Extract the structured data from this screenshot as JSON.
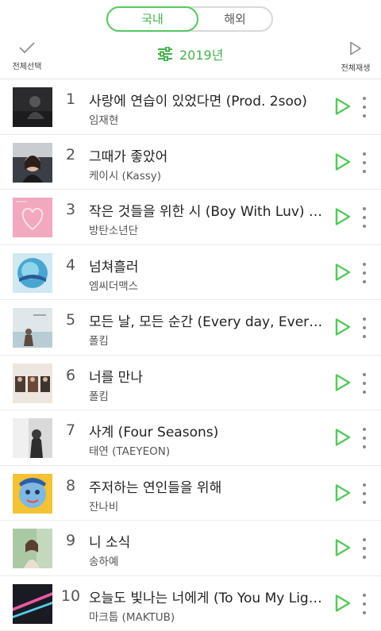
{
  "tabs": {
    "domestic": "국내",
    "international": "해외"
  },
  "toolbar": {
    "select_all": "전체선택",
    "play_all": "전체재생",
    "year": "2019년"
  },
  "colors": {
    "accent": "#44b24b"
  },
  "songs": [
    {
      "rank": "1",
      "title": "사랑에 연습이 있었다면 (Prod. 2soo)",
      "artist": "임재현"
    },
    {
      "rank": "2",
      "title": "그때가 좋았어",
      "artist": "케이시 (Kassy)"
    },
    {
      "rank": "3",
      "title": "작은 것들을 위한 시 (Boy With Luv) (Feat. Halsey)",
      "artist": "방탄소년단"
    },
    {
      "rank": "4",
      "title": "넘쳐흘러",
      "artist": "엠씨더맥스"
    },
    {
      "rank": "5",
      "title": "모든 날, 모든 순간 (Every day, Every Moment)",
      "artist": "폴킴"
    },
    {
      "rank": "6",
      "title": "너를 만나",
      "artist": "폴킴"
    },
    {
      "rank": "7",
      "title": "사계 (Four Seasons)",
      "artist": "태연 (TAEYEON)"
    },
    {
      "rank": "8",
      "title": "주저하는 연인들을 위해",
      "artist": "잔나비"
    },
    {
      "rank": "9",
      "title": "니 소식",
      "artist": "송하예"
    },
    {
      "rank": "10",
      "title": "오늘도 빛나는 너에게 (To You My Light) (Feat. 이라온)",
      "artist": "마크툽 (MAKTUB)"
    }
  ]
}
